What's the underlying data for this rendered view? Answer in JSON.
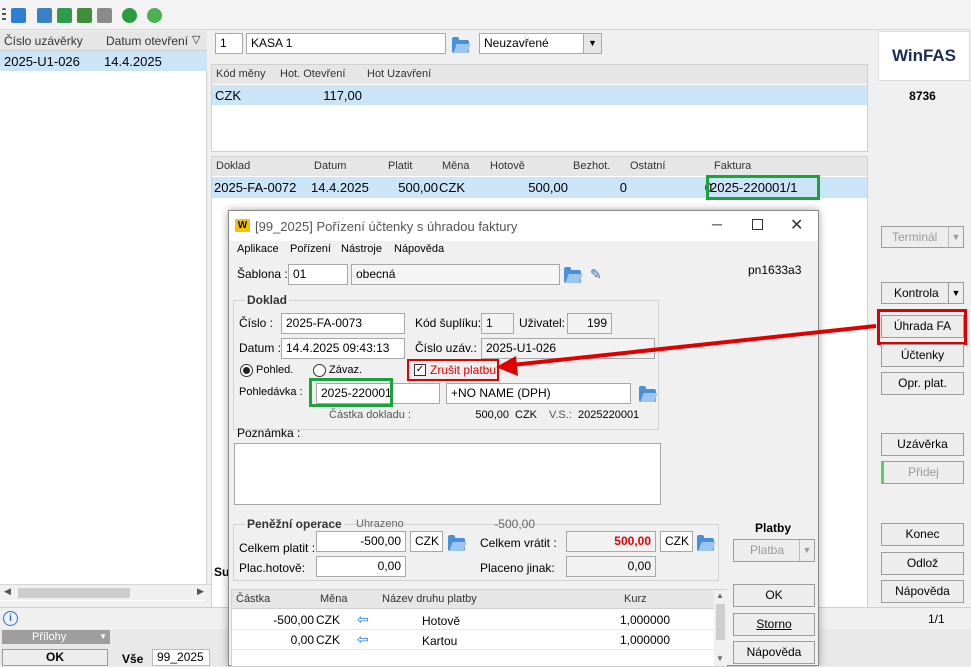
{
  "toolbar": {
    "icons": [
      "menu-icon",
      "window-icon",
      "print-icon",
      "export-icon",
      "grid-icon",
      "report-icon",
      "refresh-icon",
      "help-icon"
    ]
  },
  "left_grid": {
    "col1": "Číslo uzávěrky",
    "col2": "Datum otevření",
    "row": {
      "cislo": "2025-U1-026",
      "datum": "14.4.2025"
    }
  },
  "top_form": {
    "number": "1",
    "kasa": "KASA 1",
    "status": "Neuzavřené"
  },
  "currency_grid": {
    "headers": [
      "Kód měny",
      "Hot. Otevření",
      "Hot Uzavření"
    ],
    "row": [
      "CZK",
      "117,00",
      ""
    ]
  },
  "doc_grid": {
    "headers": [
      "Doklad",
      "Datum",
      "Platit",
      "Měna",
      "Hotově",
      "Bezhot.",
      "Ostatní",
      "Faktura"
    ],
    "row": [
      "2025-FA-0072",
      "14.4.2025",
      "500,00",
      "CZK",
      "500,00",
      "0",
      "0",
      "2025-220001/1"
    ]
  },
  "right_panel": {
    "logo": "WinFAS",
    "code": "8736",
    "terminal": "Terminál",
    "kontrola": "Kontrola",
    "uhrada": "Úhrada FA",
    "uctenky": "Účtenky",
    "opr_plat": "Opr. plat.",
    "uzaverka": "Uzávěrka",
    "pridej": "Přidej",
    "konec": "Konec",
    "odloz": "Odlož",
    "napoveda": "Nápověda",
    "pager": "1/1"
  },
  "dialog": {
    "app_icon": "W",
    "title": "[99_2025] Pořízení účtenky s úhradou faktury",
    "menu": [
      "Aplikace",
      "Pořízení",
      "Nástroje",
      "Nápověda"
    ],
    "sablona_label": "Šablona :",
    "sablona_code": "01",
    "sablona_name": "obecná",
    "pn": "pn1633a3",
    "doklad_group": "Doklad",
    "cislo_label": "Číslo :",
    "cislo": "2025-FA-0073",
    "kod_suplik_label": "Kód šuplíku:",
    "kod_suplik": "1",
    "uzivatel_label": "Uživatel:",
    "uzivatel": "199",
    "datum_label": "Datum :",
    "datum": "14.4.2025 09:43:13",
    "cislo_uzav_label": "Číslo uzáv.:",
    "cislo_uzav": "2025-U1-026",
    "pohled_radio": "Pohled.",
    "zavaz_radio": "Závaz.",
    "zrusit": "Zrušit platbu",
    "pohledavka_label": "Pohledávka :",
    "pohledavka": "2025-220001",
    "partner": "+NO NAME    (DPH)",
    "castka_label": "Částka dokladu :",
    "castka": "500,00",
    "castka_mena": "CZK",
    "vs_label": "V.S.:",
    "vs": "2025220001",
    "poznamka_label": "Poznámka :",
    "penezni_group": "Peněžní operace",
    "uhrazeno_label": "Uhrazeno",
    "uhrazeno": "-500,00",
    "celkem_platit_label": "Celkem platit :",
    "celkem_platit": "-500,00",
    "celkem_platit_mena": "CZK",
    "celkem_vratit_label": "Celkem vrátit :",
    "celkem_vratit": "500,00",
    "celkem_vratit_mena": "CZK",
    "plac_hotove_label": "Plac.hotově:",
    "plac_hotove": "0,00",
    "placeno_jinak_label": "Placeno jinak:",
    "placeno_jinak": "0,00",
    "platby_label": "Platby",
    "platba_btn": "Platba",
    "grid_headers": [
      "Částka",
      "Měna",
      "Název druhu platby",
      "Kurz"
    ],
    "grid_rows": [
      [
        "-500,00",
        "CZK",
        "Hotově",
        "1,000000"
      ],
      [
        "0,00",
        "CZK",
        "Kartou",
        "1,000000"
      ]
    ],
    "ok": "OK",
    "storno": "Storno",
    "napoveda": "Nápověda"
  },
  "behind": {
    "su": "Su",
    "prilohy": "Přílohy",
    "ok": "OK",
    "vse": "Vše",
    "doc": "99_2025"
  },
  "colors": {
    "selection": "#cce4f7",
    "annotation_red": "#e00000",
    "annotation_green": "#1aa33a",
    "red_text": "#e00000"
  }
}
